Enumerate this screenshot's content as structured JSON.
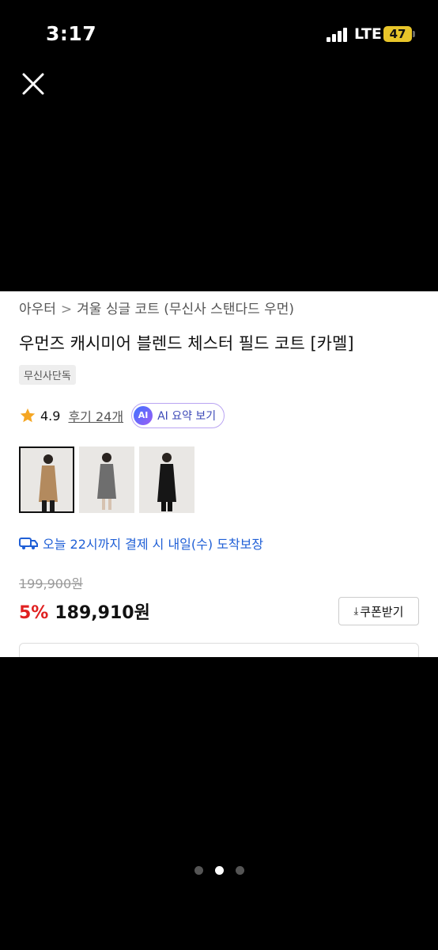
{
  "status_bar": {
    "time": "3:17",
    "network": "LTE",
    "battery": "47"
  },
  "viewer": {
    "close_icon": "close-icon",
    "page_count": 3,
    "current_page": 2
  },
  "product": {
    "breadcrumb": {
      "category": "아우터",
      "subcategory": "겨울 싱글 코트 (무신사 스탠다드 우먼)"
    },
    "title": "우먼즈 캐시미어 블렌드 체스터 필드 코트 [카멜]",
    "tag": "무신사단독",
    "rating": "4.9",
    "reviews": "후기 24개",
    "ai_badge": "AI",
    "ai_button": "AI 요약 보기",
    "thumbnails": [
      {
        "name": "camel",
        "color": "#b38a5e"
      },
      {
        "name": "grey",
        "color": "#6e6e6e"
      },
      {
        "name": "black",
        "color": "#161616"
      }
    ],
    "delivery": "오늘 22시까지 결제 시 내일(수) 도착보장",
    "original_price": "199,900원",
    "discount": "5%",
    "price": "189,910원",
    "coupon_button": "쿠폰받기"
  },
  "colors": {
    "accent_red": "#e02020",
    "delivery_blue": "#1f5fd6",
    "ai_purple": "#3d49b8"
  }
}
